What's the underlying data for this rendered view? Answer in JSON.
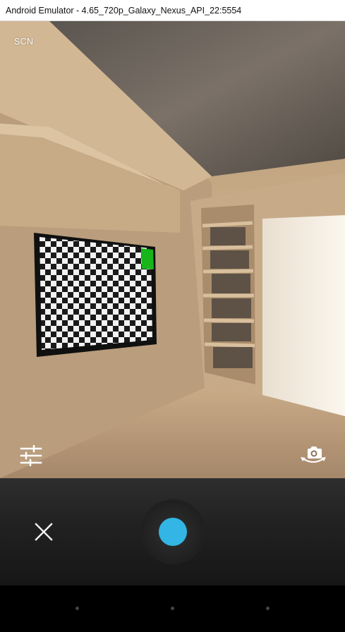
{
  "window": {
    "title": "Android Emulator - 4.65_720p_Galaxy_Nexus_API_22:5554"
  },
  "camera": {
    "scene_mode_label": "SCN",
    "settings_icon": "sliders-icon",
    "switch_camera_icon": "switch-camera-icon",
    "cancel_icon": "close-icon"
  },
  "colors": {
    "shutter_accent": "#33b5e5",
    "controls_bg": "#222222",
    "nav_bg": "#000000"
  },
  "nav": [
    "back-button",
    "home-button",
    "recents-button"
  ]
}
